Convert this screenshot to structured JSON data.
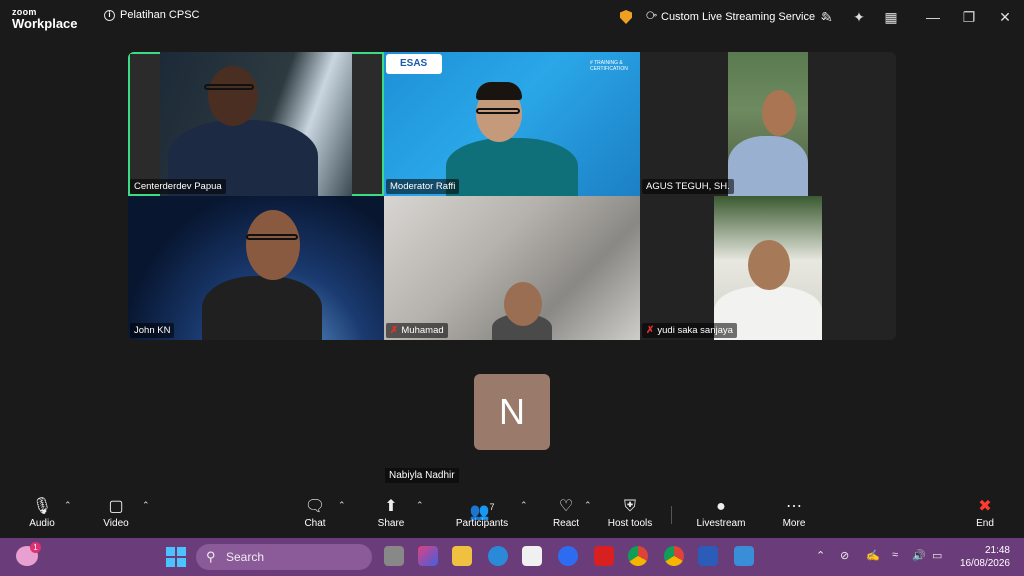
{
  "app": {
    "brand_top": "zoom",
    "brand_bottom": "Workplace",
    "meeting_title": "Pelatihan CPSC"
  },
  "titlebar": {
    "streaming_label": "Custom Live Streaming Service"
  },
  "participants": [
    {
      "name": "Centerderdev Papua",
      "muted": false,
      "active_speaker": true
    },
    {
      "name": "Moderator Raffi",
      "muted": false,
      "active_speaker": false
    },
    {
      "name": "AGUS TEGUH, SH.",
      "muted": false,
      "active_speaker": false
    },
    {
      "name": "John KN",
      "muted": false,
      "active_speaker": false
    },
    {
      "name": "Muhamad",
      "muted": true,
      "active_speaker": false
    },
    {
      "name": "yudi saka sanjaya",
      "muted": true,
      "active_speaker": false
    }
  ],
  "avatar_participant": {
    "initial": "N",
    "name": "Nabiyla Nadhir"
  },
  "esas_banner": {
    "logo_text": "ESAS",
    "right_text": "# TRAINING & CERTIFICATION"
  },
  "toolbar": {
    "audio": "Audio",
    "video": "Video",
    "chat": "Chat",
    "share": "Share",
    "participants": "Participants",
    "participants_count": "7",
    "react": "React",
    "host_tools": "Host tools",
    "livestream": "Livestream",
    "more": "More",
    "end": "End"
  },
  "taskbar": {
    "search_placeholder": "Search",
    "time": "21:48",
    "date": "16/08/2026",
    "notification_count": "1"
  },
  "colors": {
    "active_speaker": "#3ddc84",
    "mute": "#e03030",
    "taskbar": "#6a3d7a",
    "avatar_bg": "#9a7a6b"
  }
}
